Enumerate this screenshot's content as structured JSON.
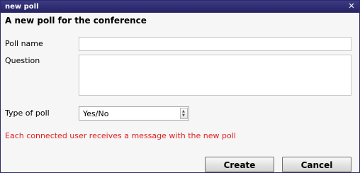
{
  "window": {
    "title": "new poll",
    "close_icon": "close-icon"
  },
  "form": {
    "heading": "A new poll for the conference",
    "poll_name_label": "Poll name",
    "poll_name_value": "",
    "question_label": "Question",
    "question_value": "",
    "type_label": "Type of poll",
    "type_selected": "Yes/No",
    "notice": "Each connected user receives a message with the new poll"
  },
  "buttons": {
    "create_label": "Create",
    "cancel_label": "Cancel"
  },
  "colors": {
    "titlebar": "#2f2c72",
    "notice": "#e02020"
  }
}
